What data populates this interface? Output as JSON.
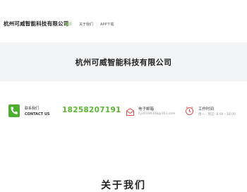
{
  "header": {
    "brand": "杭州可威智能科技有限公司",
    "nav": [
      {
        "label": "首页",
        "active": true
      },
      {
        "label": "关于我们",
        "active": false
      },
      {
        "label": "APP下载",
        "active": false
      }
    ]
  },
  "hero": {
    "title": "杭州可威智能科技有限公司"
  },
  "contact": {
    "label_cn": "联系我们",
    "label_en": "CONTACT US",
    "phone": "18258207191",
    "email_title": "电子邮箱",
    "email": "lly20190308@163.com",
    "hours_title": "工作时间",
    "hours": "周一 - 周五: 8:00 - 18:00"
  },
  "about": {
    "title": "关于我们"
  },
  "colors": {
    "accent": "#5cb531",
    "icon_red": "#e0504a"
  }
}
